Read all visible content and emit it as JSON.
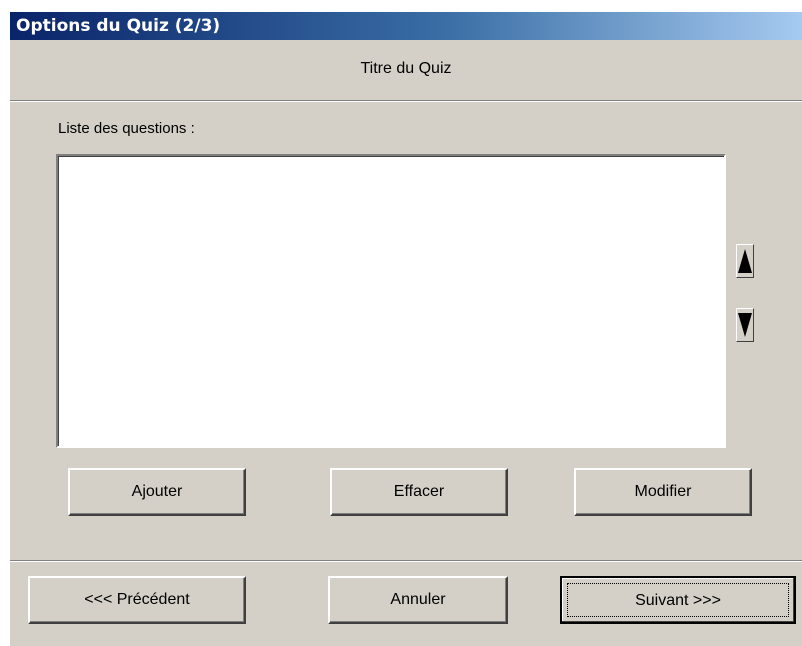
{
  "window": {
    "title": "Options du Quiz (2/3)"
  },
  "header": {
    "quiz_title": "Titre du Quiz"
  },
  "questions": {
    "label": "Liste des questions :",
    "items": []
  },
  "list_actions": {
    "add_label": "Ajouter",
    "delete_label": "Effacer",
    "edit_label": "Modifier"
  },
  "reorder": {
    "up_icon": "triangle-up-icon",
    "down_icon": "triangle-down-icon"
  },
  "footer": {
    "previous_label": "<<< Précédent",
    "cancel_label": "Annuler",
    "next_label": "Suivant >>>"
  },
  "colors": {
    "dialog_bg": "#d4d0c8",
    "titlebar_start": "#0a246a",
    "titlebar_end": "#a6caf0",
    "list_bg": "#ffffff"
  }
}
